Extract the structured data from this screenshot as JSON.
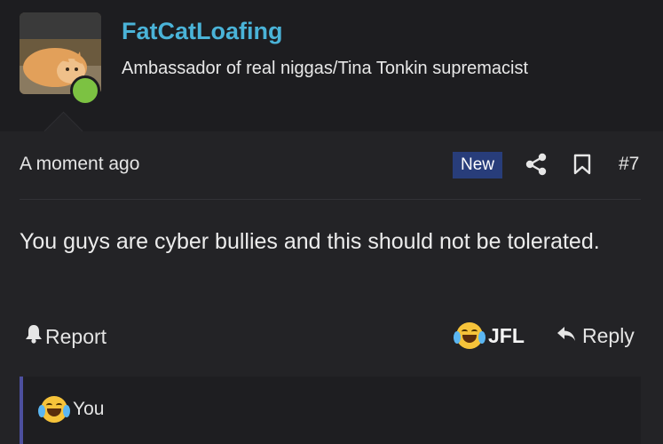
{
  "user": {
    "name": "FatCatLoafing",
    "title": "Ambassador of real niggas/Tina Tonkin supremacist"
  },
  "post": {
    "time": "A moment ago",
    "badge": "New",
    "number": "#7",
    "message": "You guys are cyber bullies and this should not be tolerated."
  },
  "actions": {
    "report_label": "Report",
    "reaction_label": "JFL",
    "reply_label": "Reply"
  },
  "reactions": {
    "summary": "You"
  },
  "colors": {
    "username": "#4ab3d8",
    "online": "#7cc242",
    "badge_bg": "#283d7a",
    "accent_border": "#4c4f9e"
  },
  "icons": [
    "share-icon",
    "bookmark-icon",
    "bell-icon",
    "reply-arrow-icon",
    "joy-emoji-icon"
  ]
}
